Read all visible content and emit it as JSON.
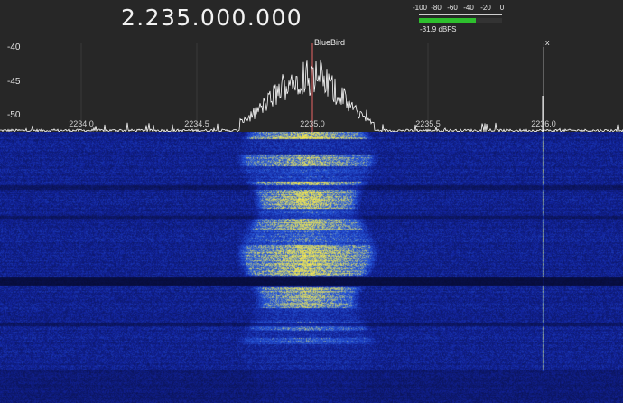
{
  "frequency_display": "2.235.000.000",
  "level_meter": {
    "ticks": [
      "-100",
      "-80",
      "-60",
      "-40",
      "-20",
      "0"
    ],
    "level_fraction": 0.68,
    "readout": "-31.9 dBFS",
    "color": "#2ec02e"
  },
  "spectrum": {
    "y_ticks": [
      "-40",
      "-45",
      "-50"
    ],
    "x_ticks": [
      "2234.0",
      "2234.5",
      "2235.0",
      "2235.5",
      "2236.0"
    ],
    "marker_label": "BlueBird",
    "close_label": "x",
    "trace_color": "#ffffff",
    "marker_color": "#c85a5a"
  },
  "waterfall": {
    "background_color": "#0a1a8c",
    "hot_color": "#ffe84a"
  }
}
